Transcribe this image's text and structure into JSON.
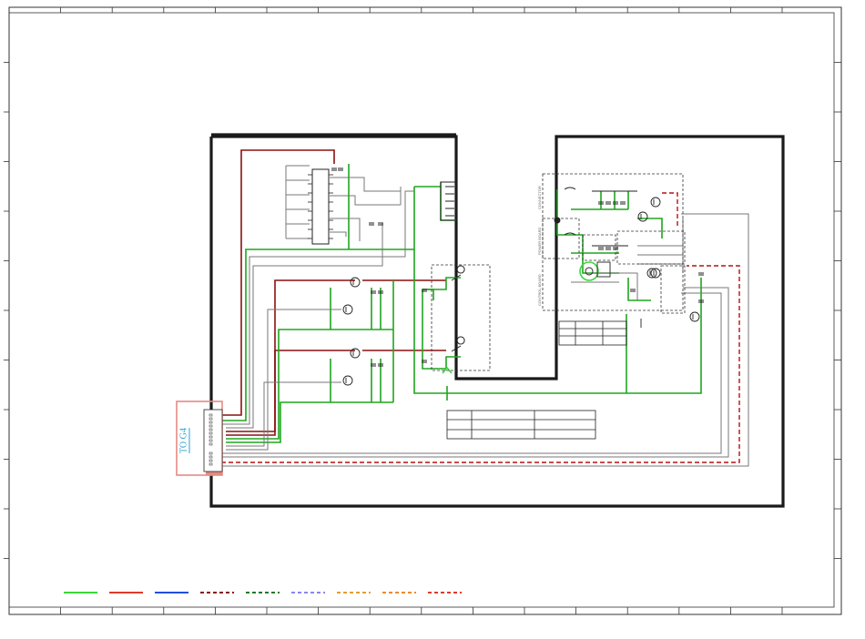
{
  "connector": {
    "label": "TO G4"
  },
  "colors": {
    "frame": "#1a1a1a",
    "green_wire": "#1fa51f",
    "dark_red_wire": "#8a1010",
    "gray_wire": "#777777",
    "connector_box": "#e58a84",
    "connector_text": "#2aa0d8"
  },
  "legend_swatches": [
    {
      "color": "#3bd63b",
      "style": "solid"
    },
    {
      "color": "#e03a2a",
      "style": "solid"
    },
    {
      "color": "#1f4fe0",
      "style": "solid"
    },
    {
      "color": "#8a1010",
      "style": "dashed"
    },
    {
      "color": "#1f7a2a",
      "style": "dashed"
    },
    {
      "color": "#8a86ee",
      "style": "dashed"
    },
    {
      "color": "#e0a030",
      "style": "dashed"
    },
    {
      "color": "#ee8a30",
      "style": "dashed"
    },
    {
      "color": "#e03a2a",
      "style": "dashed"
    }
  ]
}
